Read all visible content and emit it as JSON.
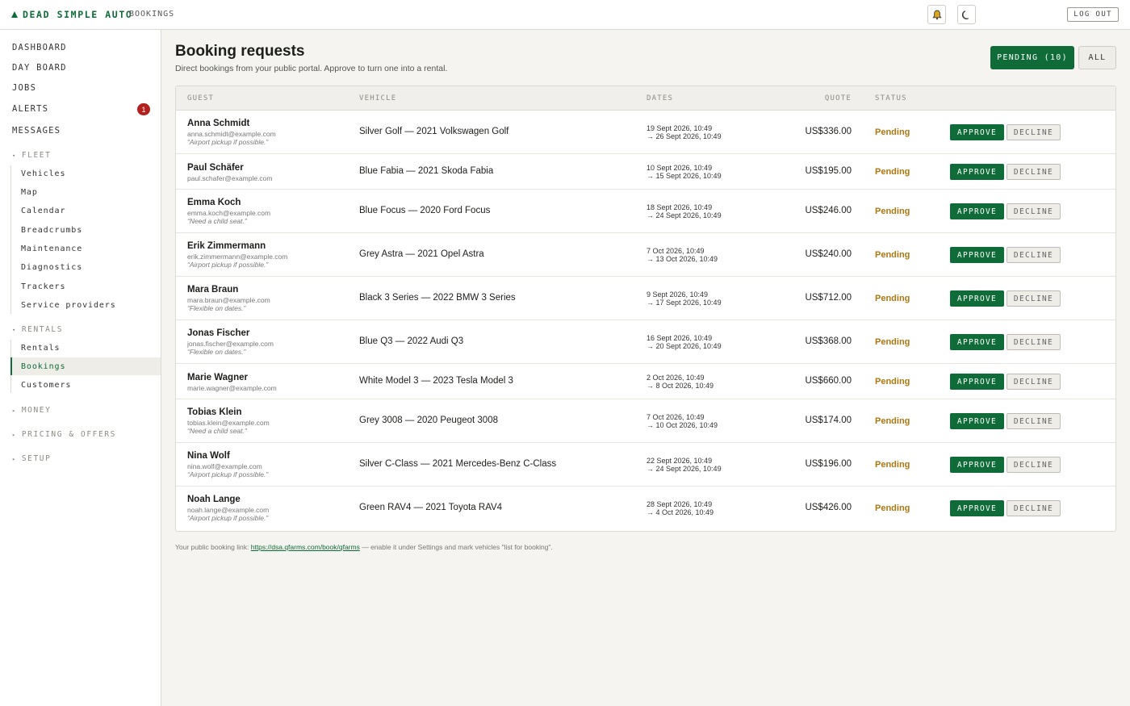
{
  "app": {
    "brand": "DEAD SIMPLE AUTO",
    "breadcrumb": "BOOKINGS",
    "logout_label": "LOG OUT"
  },
  "sidebar": {
    "top_items": [
      {
        "label": "DASHBOARD"
      },
      {
        "label": "DAY BOARD"
      },
      {
        "label": "JOBS"
      },
      {
        "label": "ALERTS",
        "badge": "1"
      },
      {
        "label": "MESSAGES"
      }
    ],
    "fleet": {
      "label": "FLEET",
      "items": [
        "Vehicles",
        "Map",
        "Calendar",
        "Breadcrumbs",
        "Maintenance",
        "Diagnostics",
        "Trackers",
        "Service providers"
      ]
    },
    "rentals": {
      "label": "RENTALS",
      "items": [
        "Rentals",
        "Bookings",
        "Customers"
      ],
      "active": "Bookings"
    },
    "collapsed": [
      "MONEY",
      "PRICING & OFFERS",
      "SETUP"
    ]
  },
  "page": {
    "title": "Booking requests",
    "subtitle": "Direct bookings from your public portal. Approve to turn one into a rental.",
    "filter_pending": "PENDING (10)",
    "filter_all": "ALL"
  },
  "table": {
    "headers": {
      "guest": "GUEST",
      "vehicle": "VEHICLE",
      "dates": "DATES",
      "quote": "QUOTE",
      "status": "STATUS"
    },
    "approve_label": "APPROVE",
    "decline_label": "DECLINE",
    "rows": [
      {
        "name": "Anna Schmidt",
        "email": "anna.schmidt@example.com",
        "note": "“Airport pickup if possible.”",
        "vehicle": "Silver Golf — 2021 Volkswagen Golf",
        "from": "19 Sept 2026, 10:49",
        "to": "→ 26 Sept 2026, 10:49",
        "quote": "US$336.00",
        "status": "Pending"
      },
      {
        "name": "Paul Schäfer",
        "email": "paul.schafer@example.com",
        "note": "",
        "vehicle": "Blue Fabia — 2021 Skoda Fabia",
        "from": "10 Sept 2026, 10:49",
        "to": "→ 15 Sept 2026, 10:49",
        "quote": "US$195.00",
        "status": "Pending"
      },
      {
        "name": "Emma Koch",
        "email": "emma.koch@example.com",
        "note": "“Need a child seat.”",
        "vehicle": "Blue Focus — 2020 Ford Focus",
        "from": "18 Sept 2026, 10:49",
        "to": "→ 24 Sept 2026, 10:49",
        "quote": "US$246.00",
        "status": "Pending"
      },
      {
        "name": "Erik Zimmermann",
        "email": "erik.zimmermann@example.com",
        "note": "“Airport pickup if possible.”",
        "vehicle": "Grey Astra — 2021 Opel Astra",
        "from": "7 Oct 2026, 10:49",
        "to": "→ 13 Oct 2026, 10:49",
        "quote": "US$240.00",
        "status": "Pending"
      },
      {
        "name": "Mara Braun",
        "email": "mara.braun@example.com",
        "note": "“Flexible on dates.”",
        "vehicle": "Black 3 Series — 2022 BMW 3 Series",
        "from": "9 Sept 2026, 10:49",
        "to": "→ 17 Sept 2026, 10:49",
        "quote": "US$712.00",
        "status": "Pending"
      },
      {
        "name": "Jonas Fischer",
        "email": "jonas.fischer@example.com",
        "note": "“Flexible on dates.”",
        "vehicle": "Blue Q3 — 2022 Audi Q3",
        "from": "16 Sept 2026, 10:49",
        "to": "→ 20 Sept 2026, 10:49",
        "quote": "US$368.00",
        "status": "Pending"
      },
      {
        "name": "Marie Wagner",
        "email": "marie.wagner@example.com",
        "note": "",
        "vehicle": "White Model 3 — 2023 Tesla Model 3",
        "from": "2 Oct 2026, 10:49",
        "to": "→ 8 Oct 2026, 10:49",
        "quote": "US$660.00",
        "status": "Pending"
      },
      {
        "name": "Tobias Klein",
        "email": "tobias.klein@example.com",
        "note": "“Need a child seat.”",
        "vehicle": "Grey 3008 — 2020 Peugeot 3008",
        "from": "7 Oct 2026, 10:49",
        "to": "→ 10 Oct 2026, 10:49",
        "quote": "US$174.00",
        "status": "Pending"
      },
      {
        "name": "Nina Wolf",
        "email": "nina.wolf@example.com",
        "note": "“Airport pickup if possible.”",
        "vehicle": "Silver C-Class — 2021 Mercedes-Benz C-Class",
        "from": "22 Sept 2026, 10:49",
        "to": "→ 24 Sept 2026, 10:49",
        "quote": "US$196.00",
        "status": "Pending"
      },
      {
        "name": "Noah Lange",
        "email": "noah.lange@example.com",
        "note": "“Airport pickup if possible.”",
        "vehicle": "Green RAV4 — 2021 Toyota RAV4",
        "from": "28 Sept 2026, 10:49",
        "to": "→ 4 Oct 2026, 10:49",
        "quote": "US$426.00",
        "status": "Pending"
      }
    ]
  },
  "footer": {
    "prefix": "Your public booking link: ",
    "link": "https://dsa.qfarms.com/book/qfarms",
    "suffix": " — enable it under Settings and mark vehicles \"list for booking\"."
  },
  "colors": {
    "accent": "#0f6b37",
    "pending": "#b0760e",
    "alert_badge": "#b3211e"
  },
  "icons": {
    "notifications": "bell-icon",
    "theme": "moon-icon",
    "brand": "triangle-logo-icon"
  }
}
